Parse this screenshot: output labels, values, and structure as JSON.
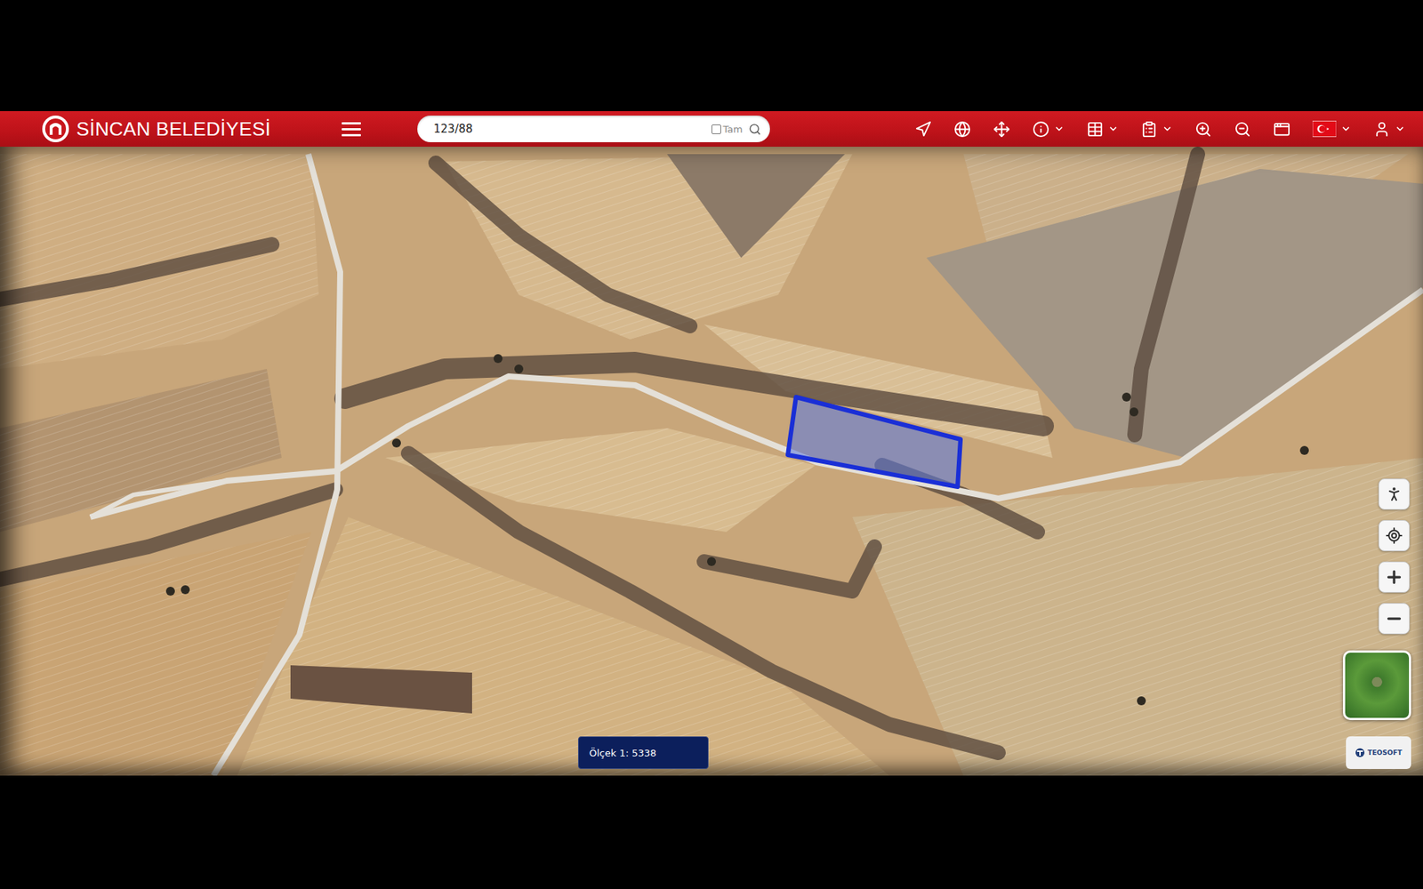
{
  "header": {
    "logo_text": "SİNCAN BELEDİYESİ"
  },
  "search": {
    "value": "123/88",
    "checkbox_label": "Tam",
    "checked": false
  },
  "toolbar": [
    {
      "has_menu": false
    },
    {
      "has_menu": false
    },
    {
      "has_menu": false
    },
    {
      "has_menu": true
    },
    {
      "has_menu": true
    },
    {
      "has_menu": true
    },
    {
      "has_menu": false
    },
    {
      "has_menu": false
    },
    {
      "has_menu": false
    },
    {
      "has_menu": true
    },
    {
      "has_menu": true
    }
  ],
  "map": {
    "scale_label": "Ölçek 1: 5338"
  },
  "attribution": {
    "label": "TEOSOFT"
  }
}
